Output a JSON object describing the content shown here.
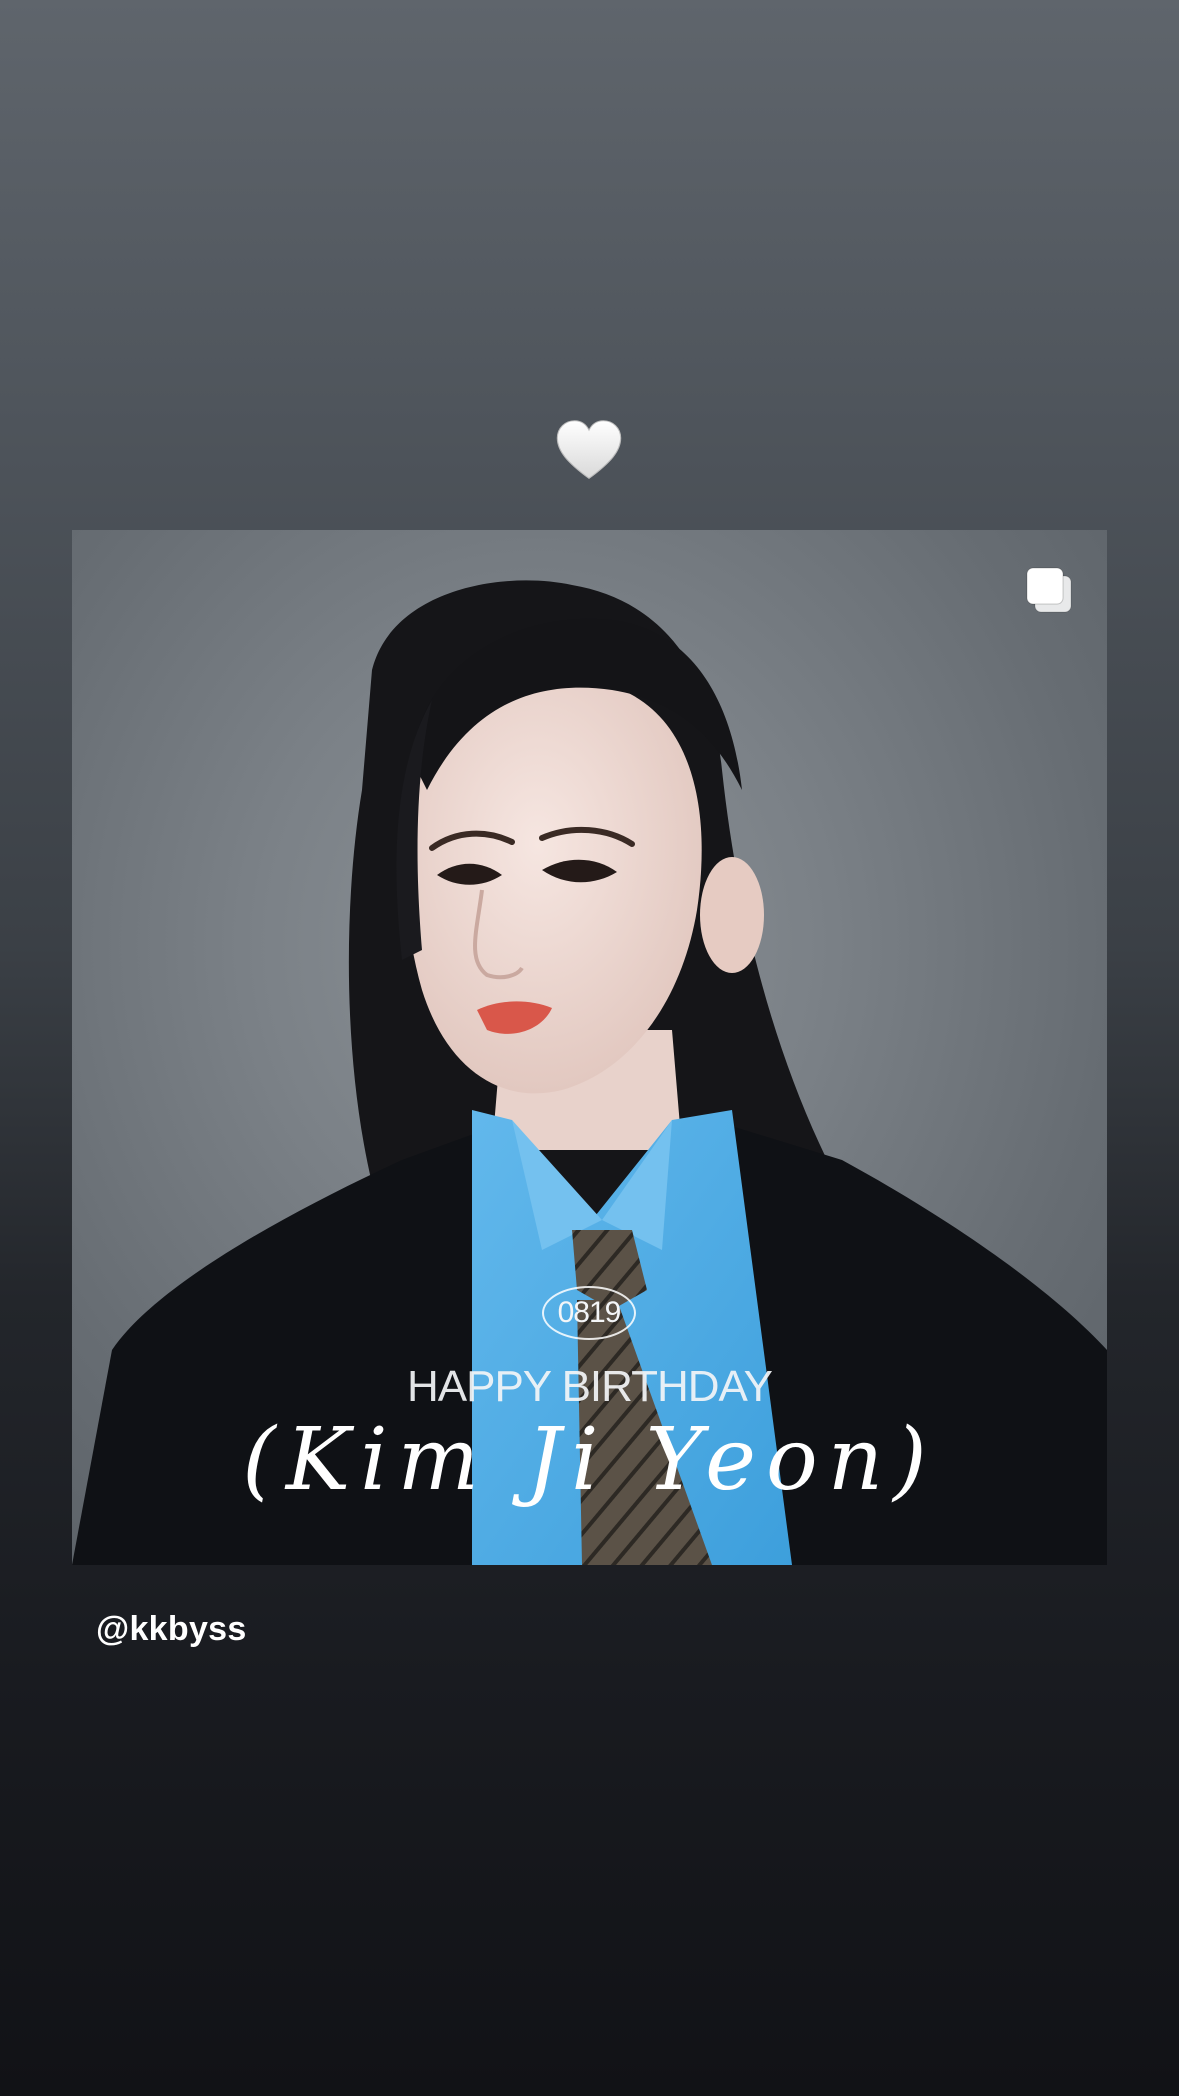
{
  "story": {
    "sticker": {
      "icon": "white-heart-icon",
      "color": "#f2f2f2"
    },
    "post": {
      "carousel_icon": "carousel-stack-icon",
      "overlay": {
        "date": "0819",
        "greeting": "HAPPY BIRTHDAY",
        "name": "(Kim Ji Yeon)"
      }
    },
    "mention": "@kkbyss"
  },
  "colors": {
    "background_top": "#5f656c",
    "background_bottom": "#111216",
    "shirt_blue": "#4aa9e4",
    "jacket": "#0f1115"
  }
}
